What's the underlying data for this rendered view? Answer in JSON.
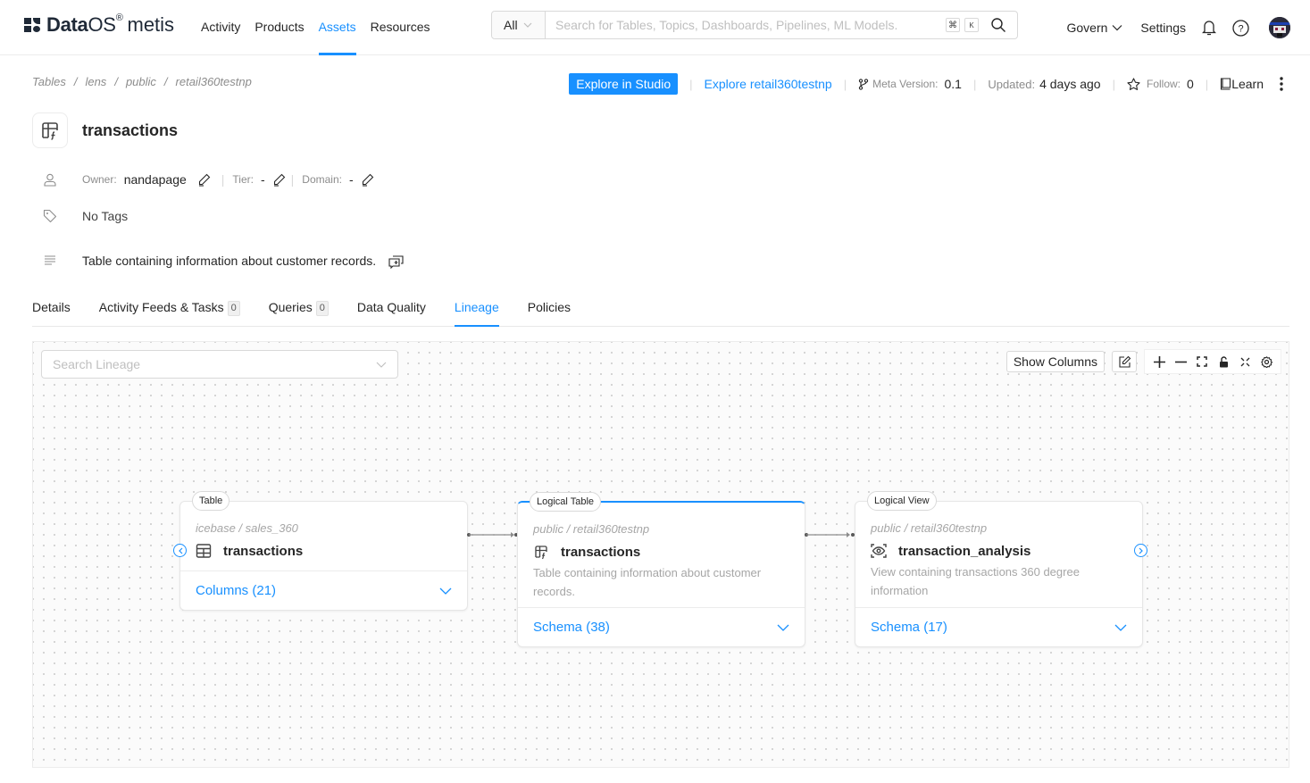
{
  "brand": {
    "name_bold": "Data",
    "name_rest": "OS",
    "reg": "®",
    "product": "metis"
  },
  "nav": {
    "links": [
      {
        "label": "Activity",
        "active": false
      },
      {
        "label": "Products",
        "active": false
      },
      {
        "label": "Assets",
        "active": true
      },
      {
        "label": "Resources",
        "active": false
      }
    ],
    "search": {
      "scope": "All",
      "placeholder": "Search for Tables, Topics, Dashboards, Pipelines, ML Models.",
      "shortcut": [
        "⌘",
        "K"
      ]
    },
    "right": {
      "govern": "Govern",
      "settings": "Settings"
    }
  },
  "breadcrumb": [
    "Tables",
    "lens",
    "public",
    "retail360testnp"
  ],
  "actions": {
    "explore_studio": "Explore in Studio",
    "explore_link": "Explore retail360testnp",
    "meta_version_label": "Meta Version:",
    "meta_version": "0.1",
    "updated_label": "Updated:",
    "updated": "4 days ago",
    "follow_label": "Follow:",
    "follow": "0",
    "learn": "Learn"
  },
  "entity": {
    "title": "transactions",
    "owner_label": "Owner:",
    "owner": "nandapage",
    "tier_label": "Tier:",
    "tier": "-",
    "domain_label": "Domain:",
    "domain": "-",
    "tags": "No Tags",
    "description": "Table containing information about customer records."
  },
  "tabs": [
    {
      "label": "Details",
      "badge": null,
      "active": false
    },
    {
      "label": "Activity Feeds & Tasks",
      "badge": "0",
      "active": false
    },
    {
      "label": "Queries",
      "badge": "0",
      "active": false
    },
    {
      "label": "Data Quality",
      "badge": null,
      "active": false
    },
    {
      "label": "Lineage",
      "badge": null,
      "active": true
    },
    {
      "label": "Policies",
      "badge": null,
      "active": false
    }
  ],
  "lineage": {
    "search_placeholder": "Search Lineage",
    "show_columns": "Show Columns",
    "nodes": [
      {
        "type": "Table",
        "path": "icebase / sales_360",
        "name": "transactions",
        "description": "",
        "footer": "Columns (21)",
        "icon": "table-icon"
      },
      {
        "type": "Logical Table",
        "path": "public / retail360testnp",
        "name": "transactions",
        "description": "Table containing information about customer records.",
        "footer": "Schema (38)",
        "icon": "logical-table-icon"
      },
      {
        "type": "Logical View",
        "path": "public / retail360testnp",
        "name": "transaction_analysis",
        "description": "View containing transactions 360 degree information",
        "footer": "Schema (17)",
        "icon": "view-icon"
      }
    ]
  },
  "colors": {
    "accent": "#1890ff",
    "text": "#262626",
    "muted": "#8c8c8c"
  }
}
